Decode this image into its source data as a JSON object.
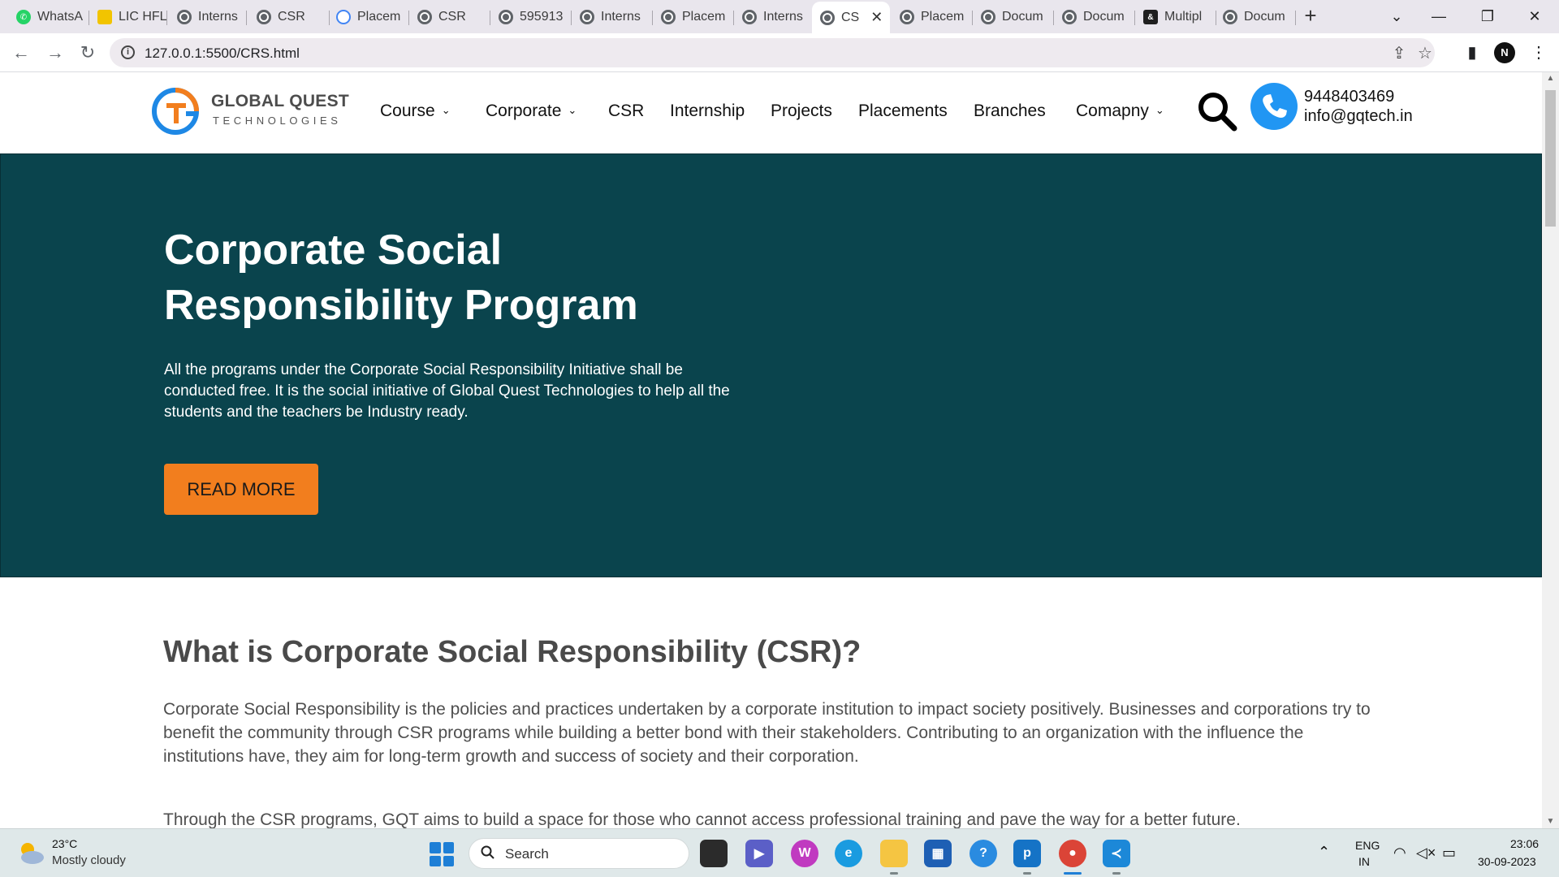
{
  "browser": {
    "tabs": [
      {
        "title": "WhatsA",
        "icon": "whatsapp-icon"
      },
      {
        "title": "LIC HFL",
        "icon": "lic-icon"
      },
      {
        "title": "Interns",
        "icon": "globe-icon"
      },
      {
        "title": "CSR",
        "icon": "globe-icon"
      },
      {
        "title": "Placem",
        "icon": "google-icon"
      },
      {
        "title": "CSR",
        "icon": "globe-icon"
      },
      {
        "title": "595913",
        "icon": "globe-icon"
      },
      {
        "title": "Interns",
        "icon": "globe-icon"
      },
      {
        "title": "Placem",
        "icon": "globe-icon"
      },
      {
        "title": "Interns",
        "icon": "globe-icon"
      },
      {
        "title": "CS",
        "icon": "globe-icon",
        "active": true
      },
      {
        "title": "Placem",
        "icon": "globe-icon"
      },
      {
        "title": "Docum",
        "icon": "globe-icon"
      },
      {
        "title": "Docum",
        "icon": "globe-icon"
      },
      {
        "title": "Multipl",
        "icon": "ms-icon"
      },
      {
        "title": "Docum",
        "icon": "globe-icon"
      }
    ],
    "close_glyph": "✕",
    "new_tab_glyph": "+",
    "url": "127.0.0.1:5500/CRS.html",
    "profile_initial": "N"
  },
  "site": {
    "logo_line1": "GLOBAL QUEST",
    "logo_line2": "TECHNOLOGIES",
    "nav": [
      "Course",
      "Corporate",
      "CSR",
      "Internship",
      "Projects",
      "Placements",
      "Branches",
      "Comapny"
    ],
    "phone": "9448403469",
    "email": "info@gqtech.in",
    "colors": {
      "hero_bg": "#0a444d",
      "button": "#f27e1e",
      "phone_circle": "#2196f3"
    }
  },
  "hero": {
    "title_line1": "Corporate Social",
    "title_line2": "Responsibility Program",
    "text": "All the programs under the Corporate Social Responsibility Initiative shall be conducted free. It is the social initiative of Global Quest Technologies to help all the students and the teachers be Industry ready.",
    "button": "READ MORE"
  },
  "section": {
    "title": "What is Corporate Social Responsibility (CSR)?",
    "p1": "Corporate Social Responsibility is the policies and practices undertaken by a corporate institution to impact society positively. Businesses and corporations try to benefit the community through CSR programs while building a better bond with their stakeholders. Contributing to an organization with the influence the institutions have, they aim for long-term growth and success of society and their corporation.",
    "p2": "Through the CSR programs, GQT aims to build a space for those who cannot access professional training and pave the way for a better future."
  },
  "taskbar": {
    "temperature": "23°C",
    "weather": "Mostly cloudy",
    "search_label": "Search",
    "lang1": "ENG",
    "lang2": "IN",
    "time": "23:06",
    "date": "30-09-2023"
  }
}
